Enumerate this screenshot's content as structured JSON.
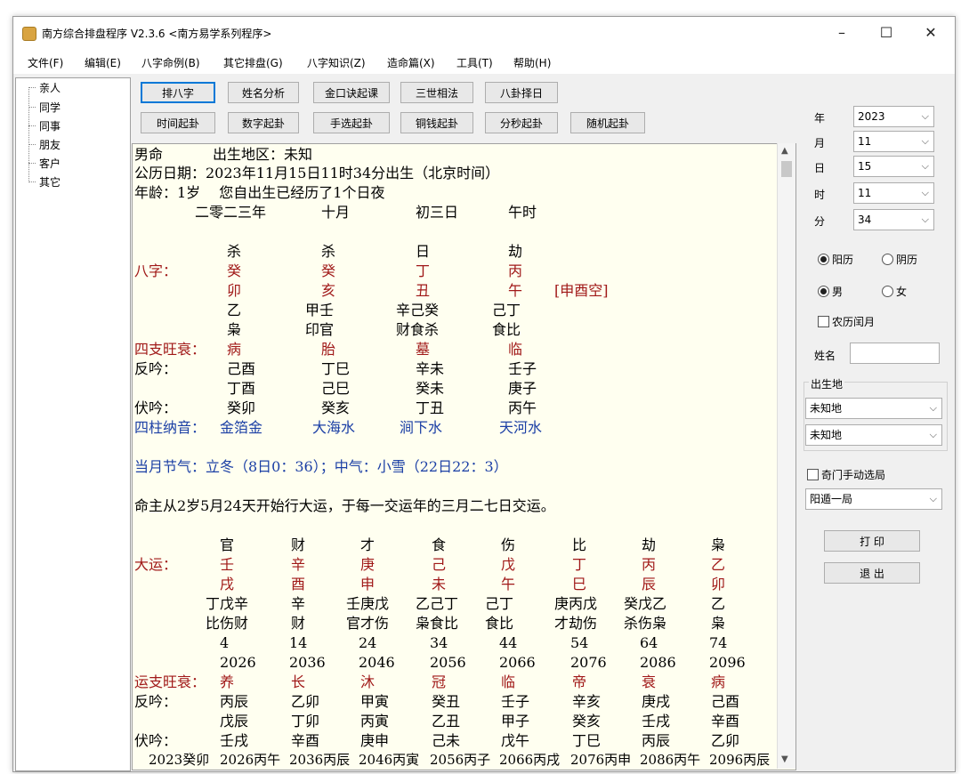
{
  "window": {
    "title": "南方综合排盘程序 V2.3.6   <南方易学系列程序>",
    "min": "–",
    "max": "☐",
    "close": "✕"
  },
  "menu": [
    "文件(F)",
    "编辑(E)",
    "八字命例(B)",
    "其它排盘(G)",
    "八字知识(Z)",
    "造命篇(X)",
    "工具(T)",
    "帮助(H)"
  ],
  "tree": [
    "亲人",
    "同学",
    "同事",
    "朋友",
    "客户",
    "其它"
  ],
  "buttons_row1": [
    "排八字",
    "姓名分析",
    "金口诀起课",
    "三世相法",
    "八卦择日"
  ],
  "buttons_row2": [
    "时间起卦",
    "数字起卦",
    "手选起卦",
    "铜钱起卦",
    "分秒起卦",
    "随机起卦"
  ],
  "right": {
    "year_label": "年",
    "year": "2023",
    "month_label": "月",
    "month": "11",
    "day_label": "日",
    "day": "15",
    "hour_label": "时",
    "hour": "11",
    "minute_label": "分",
    "minute": "34",
    "solar": "阳历",
    "lunar": "阴历",
    "male": "男",
    "female": "女",
    "leap": "农历闰月",
    "name_label": "姓名",
    "birthplace_label": "出生地",
    "place1": "未知地",
    "place2": "未知地",
    "qimen": "奇门手动选局",
    "ju": "阳遁一局",
    "print": "打 印",
    "exit": "退 出"
  },
  "text": {
    "l1a": "男命",
    "l1b": "出生地区：未知",
    "l2": "公历日期：2023年11月15日11时34分出生（北京时间）",
    "l3": "年龄：1岁　 您自出生已经历了1个日夜",
    "l4": [
      "二零二三年",
      "十月",
      "初三日",
      "午时"
    ],
    "gods": [
      "杀",
      "杀",
      "日",
      "劫"
    ],
    "bazi_label": "八字：",
    "stems": [
      "癸",
      "癸",
      "丁",
      "丙"
    ],
    "branches": [
      "卯",
      "亥",
      "丑",
      "午"
    ],
    "kong": "[申酉空]",
    "hidden": [
      "乙",
      "甲壬",
      "辛己癸",
      "己丁"
    ],
    "hidden_gods": [
      "枭",
      "印官",
      "财食杀",
      "食比"
    ],
    "wang_label": "四支旺衰：",
    "wang": [
      "病",
      "胎",
      "墓",
      "临"
    ],
    "fanyin_label": "反吟：",
    "fanyin1": [
      "己酉",
      "丁巳",
      "辛未",
      "壬子"
    ],
    "fanyin2": [
      "丁酉",
      "己巳",
      "癸未",
      "庚子"
    ],
    "fuyin_label": "伏吟：",
    "fuyin": [
      "癸卯",
      "癸亥",
      "丁丑",
      "丙午"
    ],
    "nayin_label": "四柱纳音：",
    "nayin": [
      "金箔金",
      "大海水",
      "涧下水",
      "天河水"
    ],
    "jieqi": "当月节气：立冬（8日0：36）；中气：小雪（22日22：3）",
    "dayun_start": "命主从2岁5月24天开始行大运，于每一交运年的三月二七日交运。",
    "dy_gods": [
      "官",
      "财",
      "才",
      "食",
      "伤",
      "比",
      "劫",
      "枭"
    ],
    "dy_label": "大运：",
    "dy_stems": [
      "壬",
      "辛",
      "庚",
      "己",
      "戊",
      "丁",
      "丙",
      "乙"
    ],
    "dy_branches": [
      "戌",
      "酉",
      "申",
      "未",
      "午",
      "巳",
      "辰",
      "卯"
    ],
    "dy_hidden": [
      "丁戊辛",
      "辛",
      "壬庚戊",
      "乙己丁",
      "己丁",
      "庚丙戊",
      "癸戊乙",
      "乙"
    ],
    "dy_hidden_gods": [
      "比伤财",
      "财",
      "官才伤",
      "枭食比",
      "食比",
      "才劫伤",
      "杀伤枭",
      "枭"
    ],
    "dy_ages": [
      "4",
      "14",
      "24",
      "34",
      "44",
      "54",
      "64",
      "74"
    ],
    "dy_years": [
      "2026",
      "2036",
      "2046",
      "2056",
      "2066",
      "2076",
      "2086",
      "2096"
    ],
    "yw_label": "运支旺衰：",
    "yw": [
      "养",
      "长",
      "沐",
      "冠",
      "临",
      "帝",
      "衰",
      "病"
    ],
    "dy_fan_label": "反吟：",
    "dy_fan1": [
      "丙辰",
      "乙卯",
      "甲寅",
      "癸丑",
      "壬子",
      "辛亥",
      "庚戌",
      "己酉"
    ],
    "dy_fan2": [
      "戊辰",
      "丁卯",
      "丙寅",
      "乙丑",
      "甲子",
      "癸亥",
      "壬戌",
      "辛酉"
    ],
    "dy_fu_label": "伏吟：",
    "dy_fu": [
      "壬戌",
      "辛酉",
      "庚申",
      "己未",
      "戊午",
      "丁巳",
      "丙辰",
      "乙卯"
    ],
    "last_row": [
      "2023癸卯",
      "2026丙午",
      "2036丙辰",
      "2046丙寅",
      "2056丙子",
      "2066丙戌",
      "2076丙申",
      "2086丙午",
      "2096丙辰"
    ]
  }
}
